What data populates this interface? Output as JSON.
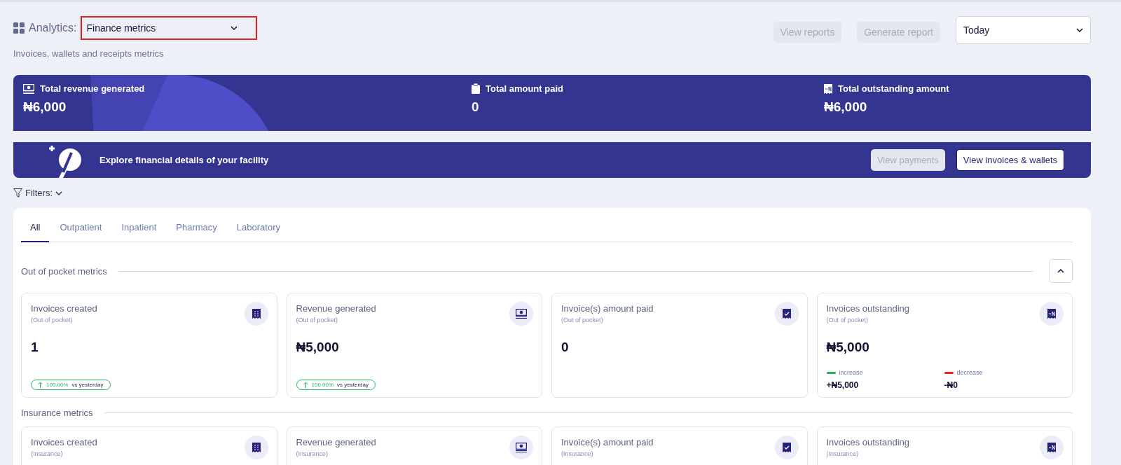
{
  "header": {
    "label": "Analytics:",
    "select_value": "Finance metrics",
    "subtitle": "Invoices, wallets and receipts metrics",
    "buttons": [
      {
        "label": "View reports",
        "disabled": true
      },
      {
        "label": "Generate report",
        "disabled": true
      }
    ],
    "period": "Today"
  },
  "summary": [
    {
      "label": "Total revenue generated",
      "value": "₦6,000"
    },
    {
      "label": "Total amount paid",
      "value": "0"
    },
    {
      "label": "Total outstanding amount",
      "value": "₦6,000"
    }
  ],
  "explore": {
    "text": "Explore financial details of your facility",
    "buttons": [
      {
        "label": "View payments",
        "disabled": true
      },
      {
        "label": "View invoices & wallets",
        "disabled": false
      }
    ]
  },
  "filters": {
    "label": "Filters:"
  },
  "tabs": [
    {
      "label": "All",
      "selected": true
    },
    {
      "label": "Outpatient",
      "selected": false
    },
    {
      "label": "Inpatient",
      "selected": false
    },
    {
      "label": "Pharmacy",
      "selected": false
    },
    {
      "label": "Laboratory",
      "selected": false
    }
  ],
  "sections": [
    {
      "title": "Out of pocket metrics",
      "expanded": true,
      "cards": [
        {
          "kind": "trend",
          "title": "Invoices created",
          "subtitle": "(Out of pocket)",
          "value": "1",
          "change": "100.00%",
          "compare": "vs  yesterday"
        },
        {
          "kind": "trend",
          "title": "Revenue generated",
          "subtitle": "(Out of pocket)",
          "value": "₦5,000",
          "change": "100.00%",
          "compare": "vs  yesterday"
        },
        {
          "kind": "plain",
          "title": "Invoice(s) amount paid",
          "subtitle": "(Out of pocket)",
          "value": "0"
        },
        {
          "kind": "split",
          "title": "Invoices outstanding",
          "subtitle": "(Out of pocket)",
          "value": "₦5,000",
          "legend": [
            {
              "label": "increase",
              "color": "#22b55a",
              "amount": "+₦5,000"
            },
            {
              "label": "decrease",
              "color": "#ff1a1a",
              "amount": "-₦0"
            }
          ]
        }
      ]
    },
    {
      "title": "Insurance metrics",
      "cards": [
        {
          "kind": "plain",
          "title": "Invoices created",
          "subtitle": "(Insurance)"
        },
        {
          "kind": "plain",
          "title": "Revenue generated",
          "subtitle": "(Insurance)"
        },
        {
          "kind": "plain",
          "title": "Invoice(s) amount paid",
          "subtitle": "(Insurance)"
        },
        {
          "kind": "plain",
          "title": "Invoices outstanding",
          "subtitle": "(Insurance)"
        }
      ]
    }
  ]
}
